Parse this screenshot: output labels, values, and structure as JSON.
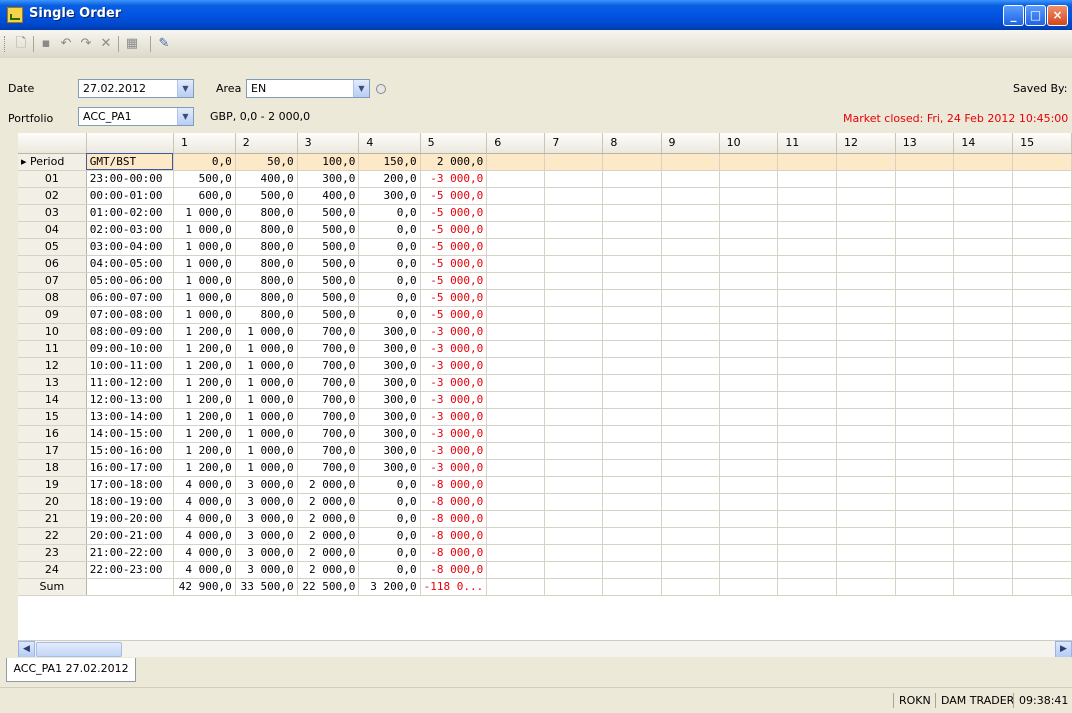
{
  "window": {
    "title": "Single Order"
  },
  "filter": {
    "date_label": "Date",
    "date_value": "27.02.2012",
    "area_label": "Area",
    "area_value": "EN",
    "saved_by_label": "Saved By:",
    "portfolio_label": "Portfolio",
    "portfolio_value": "ACC_PA1",
    "currency_info": "GBP, 0,0 - 2 000,0",
    "market_status": "Market closed: Fri, 24 Feb 2012 10:45:00"
  },
  "grid": {
    "columns": [
      "1",
      "2",
      "3",
      "4",
      "5",
      "6",
      "7",
      "8",
      "9",
      "10",
      "11",
      "12",
      "13",
      "14",
      "15"
    ],
    "period_row": {
      "label": "Period",
      "period": "GMT/BST",
      "values": [
        "0,0",
        "50,0",
        "100,0",
        "150,0",
        "2 000,0"
      ]
    },
    "rows": [
      {
        "label": "01",
        "period": "23:00-00:00",
        "values": [
          "500,0",
          "400,0",
          "300,0",
          "200,0",
          "-3 000,0"
        ]
      },
      {
        "label": "02",
        "period": "00:00-01:00",
        "values": [
          "600,0",
          "500,0",
          "400,0",
          "300,0",
          "-5 000,0"
        ]
      },
      {
        "label": "03",
        "period": "01:00-02:00",
        "values": [
          "1 000,0",
          "800,0",
          "500,0",
          "0,0",
          "-5 000,0"
        ]
      },
      {
        "label": "04",
        "period": "02:00-03:00",
        "values": [
          "1 000,0",
          "800,0",
          "500,0",
          "0,0",
          "-5 000,0"
        ]
      },
      {
        "label": "05",
        "period": "03:00-04:00",
        "values": [
          "1 000,0",
          "800,0",
          "500,0",
          "0,0",
          "-5 000,0"
        ]
      },
      {
        "label": "06",
        "period": "04:00-05:00",
        "values": [
          "1 000,0",
          "800,0",
          "500,0",
          "0,0",
          "-5 000,0"
        ]
      },
      {
        "label": "07",
        "period": "05:00-06:00",
        "values": [
          "1 000,0",
          "800,0",
          "500,0",
          "0,0",
          "-5 000,0"
        ]
      },
      {
        "label": "08",
        "period": "06:00-07:00",
        "values": [
          "1 000,0",
          "800,0",
          "500,0",
          "0,0",
          "-5 000,0"
        ]
      },
      {
        "label": "09",
        "period": "07:00-08:00",
        "values": [
          "1 000,0",
          "800,0",
          "500,0",
          "0,0",
          "-5 000,0"
        ]
      },
      {
        "label": "10",
        "period": "08:00-09:00",
        "values": [
          "1 200,0",
          "1 000,0",
          "700,0",
          "300,0",
          "-3 000,0"
        ]
      },
      {
        "label": "11",
        "period": "09:00-10:00",
        "values": [
          "1 200,0",
          "1 000,0",
          "700,0",
          "300,0",
          "-3 000,0"
        ]
      },
      {
        "label": "12",
        "period": "10:00-11:00",
        "values": [
          "1 200,0",
          "1 000,0",
          "700,0",
          "300,0",
          "-3 000,0"
        ]
      },
      {
        "label": "13",
        "period": "11:00-12:00",
        "values": [
          "1 200,0",
          "1 000,0",
          "700,0",
          "300,0",
          "-3 000,0"
        ]
      },
      {
        "label": "14",
        "period": "12:00-13:00",
        "values": [
          "1 200,0",
          "1 000,0",
          "700,0",
          "300,0",
          "-3 000,0"
        ]
      },
      {
        "label": "15",
        "period": "13:00-14:00",
        "values": [
          "1 200,0",
          "1 000,0",
          "700,0",
          "300,0",
          "-3 000,0"
        ]
      },
      {
        "label": "16",
        "period": "14:00-15:00",
        "values": [
          "1 200,0",
          "1 000,0",
          "700,0",
          "300,0",
          "-3 000,0"
        ]
      },
      {
        "label": "17",
        "period": "15:00-16:00",
        "values": [
          "1 200,0",
          "1 000,0",
          "700,0",
          "300,0",
          "-3 000,0"
        ]
      },
      {
        "label": "18",
        "period": "16:00-17:00",
        "values": [
          "1 200,0",
          "1 000,0",
          "700,0",
          "300,0",
          "-3 000,0"
        ]
      },
      {
        "label": "19",
        "period": "17:00-18:00",
        "values": [
          "4 000,0",
          "3 000,0",
          "2 000,0",
          "0,0",
          "-8 000,0"
        ]
      },
      {
        "label": "20",
        "period": "18:00-19:00",
        "values": [
          "4 000,0",
          "3 000,0",
          "2 000,0",
          "0,0",
          "-8 000,0"
        ]
      },
      {
        "label": "21",
        "period": "19:00-20:00",
        "values": [
          "4 000,0",
          "3 000,0",
          "2 000,0",
          "0,0",
          "-8 000,0"
        ]
      },
      {
        "label": "22",
        "period": "20:00-21:00",
        "values": [
          "4 000,0",
          "3 000,0",
          "2 000,0",
          "0,0",
          "-8 000,0"
        ]
      },
      {
        "label": "23",
        "period": "21:00-22:00",
        "values": [
          "4 000,0",
          "3 000,0",
          "2 000,0",
          "0,0",
          "-8 000,0"
        ]
      },
      {
        "label": "24",
        "period": "22:00-23:00",
        "values": [
          "4 000,0",
          "3 000,0",
          "2 000,0",
          "0,0",
          "-8 000,0"
        ]
      }
    ],
    "sum_row": {
      "label": "Sum",
      "values": [
        "42 900,0",
        "33 500,0",
        "22 500,0",
        "3 200,0",
        "-118 0..."
      ]
    }
  },
  "tabs": [
    {
      "label": "ACC_PA1 27.02.2012"
    }
  ],
  "status_bar": {
    "user": "ROKN",
    "role": "DAM TRADER",
    "time": "09:38:41"
  },
  "colors": {
    "negative": "#e8000b",
    "period_row": "#fde8c8",
    "title_bar": "#0054e3"
  }
}
